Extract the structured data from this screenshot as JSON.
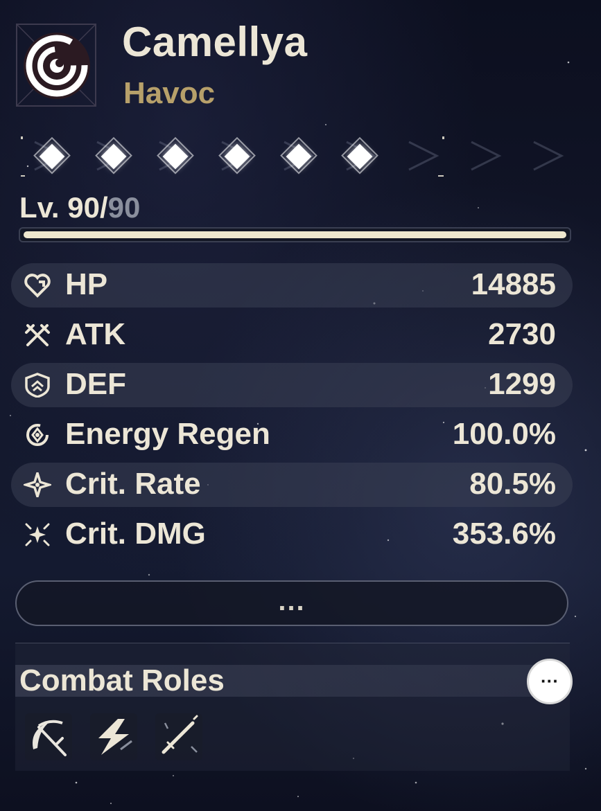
{
  "character": {
    "name": "Camellya",
    "attribute": "Havoc",
    "emblem_icon": "havoc-spiral-icon"
  },
  "sequence": {
    "nodes": 6,
    "active": 6,
    "icon": "diamond-node-icon"
  },
  "level": {
    "prefix": "Lv. ",
    "current": "90",
    "separator": "/",
    "max": "90",
    "progress": 1.0
  },
  "stats": [
    {
      "label": "HP",
      "value": "14885",
      "icon": "heart-icon"
    },
    {
      "label": "ATK",
      "value": "2730",
      "icon": "crossed-swords-icon"
    },
    {
      "label": "DEF",
      "value": "1299",
      "icon": "shield-icon"
    },
    {
      "label": "Energy Regen",
      "value": "100.0%",
      "icon": "energy-regen-icon"
    },
    {
      "label": "Crit. Rate",
      "value": "80.5%",
      "icon": "crit-rate-star-icon"
    },
    {
      "label": "Crit. DMG",
      "value": "353.6%",
      "icon": "crit-dmg-burst-icon"
    }
  ],
  "more_button": {
    "label": "..."
  },
  "combat_roles": {
    "title": "Combat Roles",
    "more_label": "···",
    "roles": [
      {
        "icon": "scythe-slash-icon"
      },
      {
        "icon": "lightning-bolt-icon"
      },
      {
        "icon": "sword-strike-icon"
      }
    ]
  },
  "colors": {
    "attribute_gold": "#b7a06a",
    "text_primary": "#ece6d6",
    "level_max_gray": "#8a8f9d",
    "progress_fill": "#efe8cf"
  }
}
